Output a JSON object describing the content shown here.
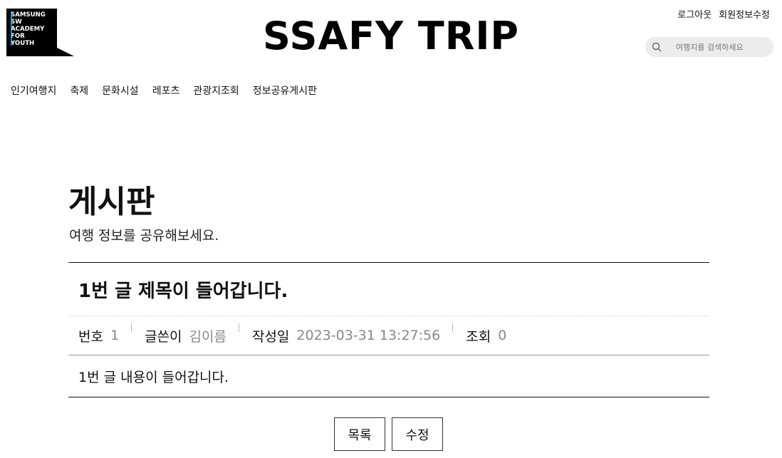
{
  "header": {
    "logo_lines": [
      "SAMSUNG",
      "SW",
      "ACADEMY",
      "FOR",
      "YOUTH"
    ],
    "site_title": "SSAFY TRIP",
    "user_links": [
      {
        "label": "로그아웃"
      },
      {
        "label": "회원정보수정"
      }
    ],
    "search": {
      "placeholder": "여행지를 검색하세요",
      "icon": "search-icon"
    }
  },
  "nav": {
    "items": [
      {
        "label": "인기여행지"
      },
      {
        "label": "축제"
      },
      {
        "label": "문화시설"
      },
      {
        "label": "레포츠"
      },
      {
        "label": "관광지조회"
      },
      {
        "label": "정보공유게시판"
      }
    ]
  },
  "board": {
    "title": "게시판",
    "subtitle": "여행 정보를 공유해보세요."
  },
  "post": {
    "title": "1번 글 제목이 들어갑니다.",
    "meta": [
      {
        "label": "번호",
        "value": "1"
      },
      {
        "label": "글쓴이",
        "value": "김이름"
      },
      {
        "label": "작성일",
        "value": "2023-03-31 13:27:56"
      },
      {
        "label": "조회",
        "value": "0"
      }
    ],
    "content": "1번 글 내용이 들어갑니다."
  },
  "actions": {
    "list_label": "목록",
    "edit_label": "수정"
  },
  "colors": {
    "logo_bg": "#000000",
    "logo_accent": "#19a7e8",
    "search_bg": "#ececec",
    "meta_value": "#888888"
  }
}
